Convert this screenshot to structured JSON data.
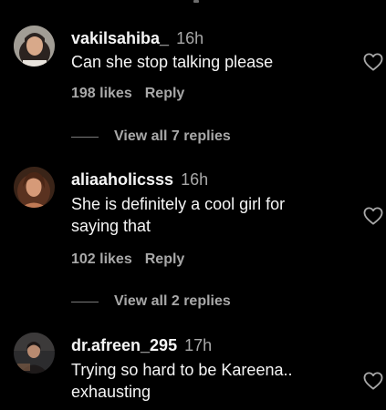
{
  "colors": {
    "background": "#000000",
    "primary_text": "#f5f5f5",
    "secondary_text": "#a8a8a8"
  },
  "comments": [
    {
      "username": "vakilsahiba_",
      "time": "16h",
      "text": "Can she stop talking please",
      "likes": "198 likes",
      "reply_label": "Reply",
      "view_replies": "View all 7 replies",
      "like_icon": "heart-outline-icon"
    },
    {
      "username": "aliaaholicsss",
      "time": "16h",
      "text": "She is definitely a cool girl for\nsaying that",
      "likes": "102 likes",
      "reply_label": "Reply",
      "view_replies": "View all 2 replies",
      "like_icon": "heart-outline-icon"
    },
    {
      "username": "dr.afreen_295",
      "time": "17h",
      "text": "Trying so hard to be Kareena..\nexhausting",
      "like_icon": "heart-outline-icon"
    }
  ]
}
